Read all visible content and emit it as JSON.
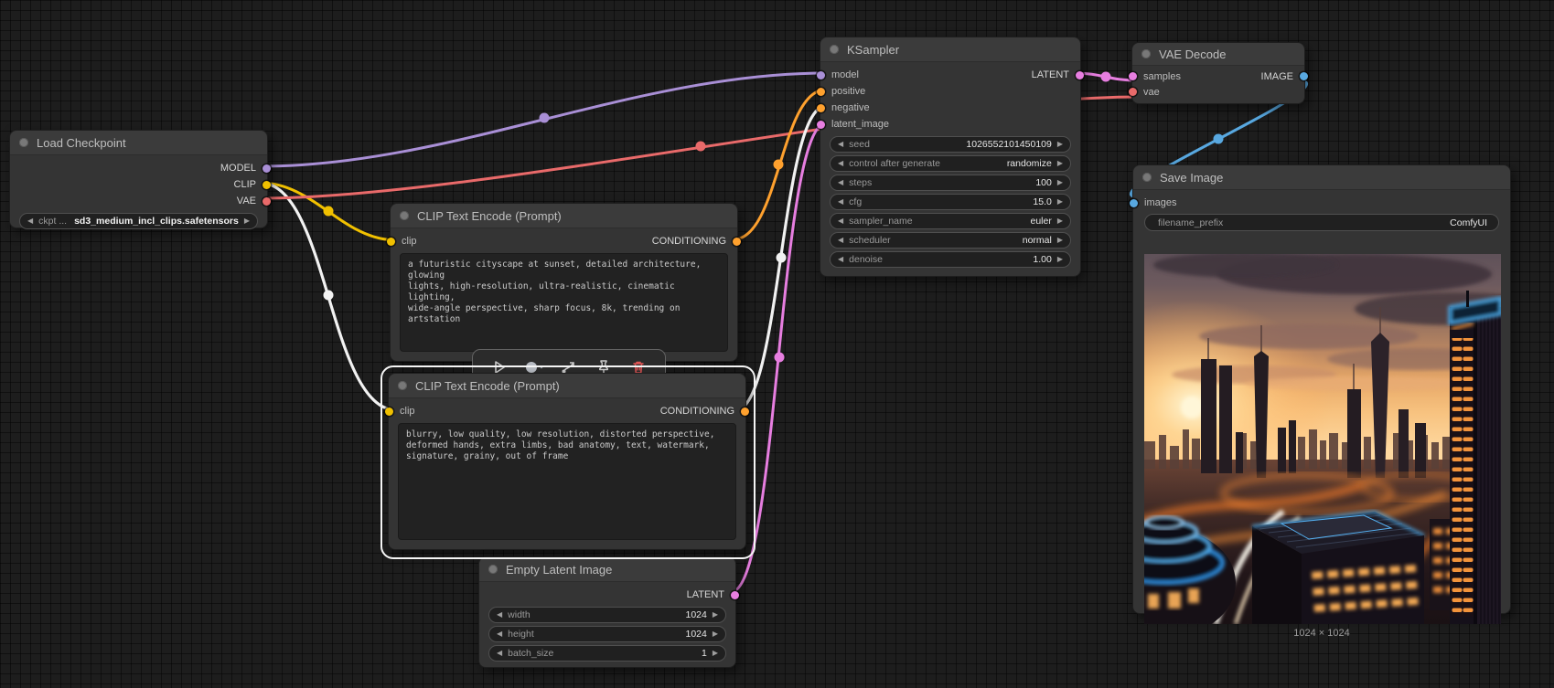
{
  "icons": {
    "decrement_arrow": "◀",
    "increment_arrow": "▶"
  },
  "nodes": {
    "load_checkpoint": {
      "title": "Load Checkpoint",
      "outputs": {
        "model": "MODEL",
        "clip": "CLIP",
        "vae": "VAE"
      },
      "widgets": [
        {
          "label": "ckpt ...",
          "value": "sd3_medium_incl_clips.safetensors"
        }
      ]
    },
    "clip_encode_positive": {
      "title": "CLIP Text Encode (Prompt)",
      "inputs": {
        "clip": "clip"
      },
      "outputs": {
        "conditioning": "CONDITIONING"
      },
      "text": "a futuristic cityscape at sunset, detailed architecture, glowing\nlights, high-resolution, ultra-realistic, cinematic lighting,\nwide-angle perspective, sharp focus, 8k, trending on artstation"
    },
    "clip_encode_negative": {
      "title": "CLIP Text Encode (Prompt)",
      "inputs": {
        "clip": "clip"
      },
      "outputs": {
        "conditioning": "CONDITIONING"
      },
      "text": "blurry, low quality, low resolution, distorted perspective,\ndeformed hands, extra limbs, bad anatomy, text, watermark,\nsignature, grainy, out of frame"
    },
    "empty_latent_image": {
      "title": "Empty Latent Image",
      "outputs": {
        "latent": "LATENT"
      },
      "widgets": [
        {
          "label": "width",
          "value": "1024"
        },
        {
          "label": "height",
          "value": "1024"
        },
        {
          "label": "batch_size",
          "value": "1"
        }
      ]
    },
    "ksampler": {
      "title": "KSampler",
      "inputs": {
        "model": "model",
        "positive": "positive",
        "negative": "negative",
        "latent_image": "latent_image"
      },
      "outputs": {
        "latent": "LATENT"
      },
      "widgets": [
        {
          "label": "seed",
          "value": "1026552101450109"
        },
        {
          "label": "control after generate",
          "value": "randomize"
        },
        {
          "label": "steps",
          "value": "100"
        },
        {
          "label": "cfg",
          "value": "15.0"
        },
        {
          "label": "sampler_name",
          "value": "euler"
        },
        {
          "label": "scheduler",
          "value": "normal"
        },
        {
          "label": "denoise",
          "value": "1.00"
        }
      ]
    },
    "vae_decode": {
      "title": "VAE Decode",
      "inputs": {
        "samples": "samples",
        "vae": "vae"
      },
      "outputs": {
        "image": "IMAGE"
      }
    },
    "save_image": {
      "title": "Save Image",
      "inputs": {
        "images": "images"
      },
      "widgets": [
        {
          "label": "filename_prefix",
          "value": "ComfyUI"
        }
      ],
      "caption": "1024 × 1024"
    }
  },
  "colors": {
    "model": "#a98fd6",
    "clip": "#f0c000",
    "vae": "#e96a6a",
    "conditioning": "#ffa12e",
    "latent": "#e77ee0",
    "image": "#58a8e0",
    "link_highlight": "#f2f2f2"
  }
}
